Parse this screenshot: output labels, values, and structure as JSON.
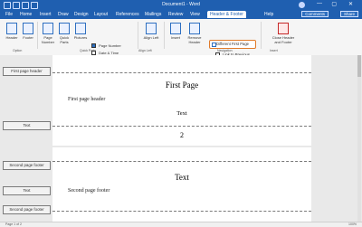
{
  "window": {
    "title": "Document1 - Word"
  },
  "ribbon": {
    "tabs": [
      "File",
      "Home",
      "Insert",
      "Draw",
      "Design",
      "Layout",
      "References",
      "Mailings",
      "Review",
      "View",
      "Header & Footer"
    ],
    "active_tab": "Header & Footer",
    "extra_tab": "Help",
    "user_area": "Comments",
    "share_label": "Share",
    "buttons": {
      "header": "Header",
      "footer": "Footer",
      "page_number": "Page Number",
      "quick_parts": "Quick Parts",
      "pictures": "Pictures",
      "online_pictures": "Online Pictures",
      "date_time": "Date & Time",
      "document_info": "Document Info",
      "align_left": "Align Left",
      "insert": "Insert",
      "remove_header": "Remove Header",
      "different_first_page": "Different First Page",
      "link_to_previous": "Link to Previous",
      "close_header_footer": "Close Header and Footer"
    },
    "group_labels": {
      "option": "Option",
      "quick_parts_label": "Quick Parts",
      "align_left_label": "Align Left",
      "navigation": "Navigation",
      "insert": "Insert",
      "close": "Close"
    }
  },
  "document": {
    "tags": {
      "first_page_header": "First page header",
      "text_1": "Text",
      "second_page_footer": "Second page footer",
      "text_2": "Text",
      "second_page_footer_2": "Second page footer"
    },
    "page1": {
      "title": "First Page",
      "first_page_header_text": "First page header",
      "center_text": "Text",
      "page_number": "2"
    },
    "page2": {
      "center_text": "Text",
      "second_page_footer_text": "Second page footer"
    }
  },
  "status": {
    "left": "Page 1 of 2",
    "right": "100%"
  },
  "colors": {
    "brand": "#1f5fb0",
    "highlight": "#e07b2a"
  }
}
